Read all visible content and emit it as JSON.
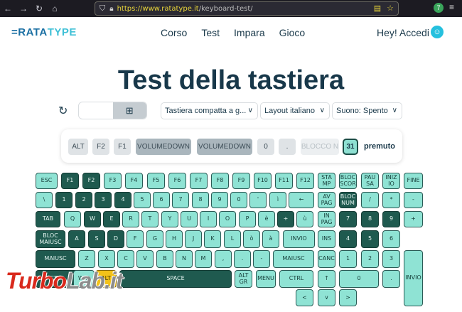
{
  "browser": {
    "url_host": "https://www.ratatype.it",
    "url_path": "/keyboard-test/",
    "extension_badge": "7"
  },
  "site": {
    "logo_prefix": "=RATA",
    "logo_suffix": "TYPE",
    "nav": [
      "Corso",
      "Test",
      "Impara",
      "Gioco"
    ],
    "account": "Hey! Accedi"
  },
  "title": "Test della tastiera",
  "controls": {
    "keyboard_type": "Tastiera compatta a g...",
    "layout": "Layout italiano",
    "sound": "Suono: Spento",
    "os_selected": "windows"
  },
  "pressed": {
    "keys": [
      "ALT",
      "F2",
      "F1",
      "VOLUMEDOWN",
      "VOLUMEDOWN",
      "0",
      ".",
      "BLOCCO N"
    ],
    "count": "31",
    "count_label": "premuto"
  },
  "keyboard": {
    "row1": [
      "ESC",
      "F1",
      "F2",
      "F3",
      "F4",
      "F5",
      "F6",
      "F7",
      "F8",
      "F9",
      "F10",
      "F11",
      "F12",
      "STA\nMP",
      "BLOC\nSCOR",
      "PAU\nSA",
      "INIZ\nIO",
      "FINE"
    ],
    "row2": [
      "\\",
      "1",
      "2",
      "3",
      "4",
      "5",
      "6",
      "7",
      "8",
      "9",
      "0",
      "'",
      "ì",
      "←",
      "AV\nPAG",
      "BLOC\nNUM",
      "/",
      "*",
      "-"
    ],
    "row3": [
      "TAB",
      "Q",
      "W",
      "E",
      "R",
      "T",
      "Y",
      "U",
      "I",
      "O",
      "P",
      "è",
      "+",
      "ù",
      "IN\nPAG",
      "7",
      "8",
      "9",
      "+"
    ],
    "row4": [
      "BLOC\nMAIUSC",
      "A",
      "S",
      "D",
      "F",
      "G",
      "H",
      "J",
      "K",
      "L",
      "ò",
      "à",
      "INVIO",
      "INS",
      "4",
      "5",
      "6"
    ],
    "row5": [
      "MAIUSC",
      "Z",
      "X",
      "C",
      "V",
      "B",
      "N",
      "M",
      ",",
      ".",
      "-",
      "MAIUSC",
      "CANC",
      "1",
      "2",
      "3",
      "INVIO"
    ],
    "row6": [
      "CTRL",
      "WIN",
      "ALT",
      "SPACE",
      "ALT\nGR",
      "MENU",
      "CTRL",
      "↑",
      "0",
      "."
    ],
    "arrows": [
      "<",
      "∨",
      ">"
    ]
  },
  "watermark": {
    "text_a": "Turbo",
    "text_b": "Lab.it"
  }
}
